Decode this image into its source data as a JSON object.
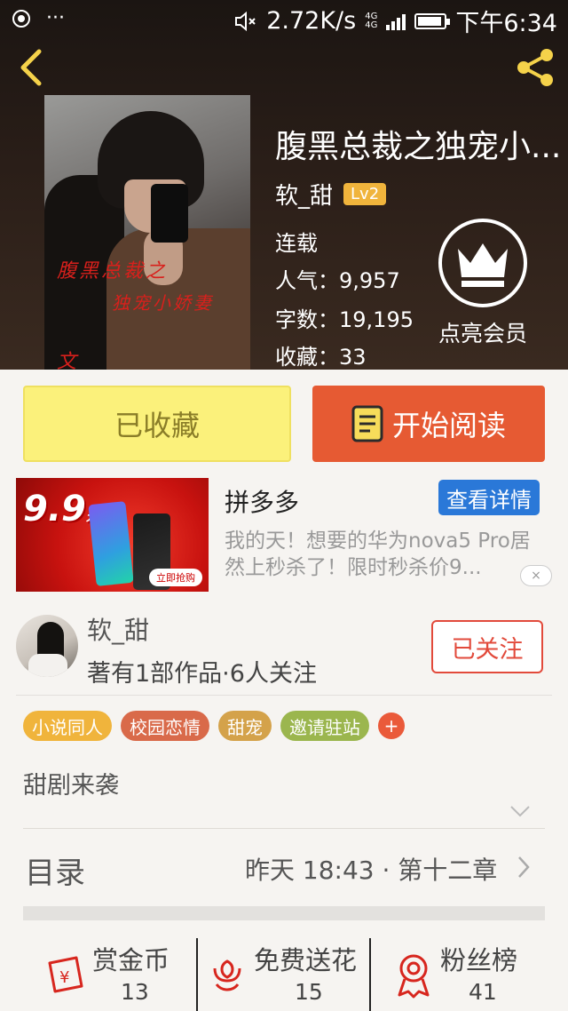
{
  "status_bar": {
    "menu_dots": "···",
    "speed": "2.72K/s",
    "net_type_1": "4G",
    "net_type_2": "4G",
    "time": "下午6:34"
  },
  "book": {
    "title": "腹黑总裁之独宠小...",
    "author": "软_甜",
    "author_level": "Lv2",
    "status": "连载",
    "popularity_label": "人气：",
    "popularity": "9,957",
    "words_label": "字数：",
    "words": "19,195",
    "favorites_label": "收藏：",
    "favorites": "33",
    "cover_text_line1": "腹黑总裁之",
    "cover_text_line2": "独宠小娇妻",
    "cover_text_line3": "文"
  },
  "vip": {
    "label": "点亮会员"
  },
  "actions": {
    "favorited_label": "已收藏",
    "read_label": "开始阅读"
  },
  "ad": {
    "price_text": "9.9",
    "price_unit": "元",
    "grab_text": "立即抢购",
    "title": "拼多多",
    "detail_button": "查看详情",
    "description": "我的天！想要的华为nova5 Pro居然上秒杀了！限时秒杀价9...",
    "close_icon": "close-icon"
  },
  "author_info": {
    "name": "软_甜",
    "stats": "著有1部作品·6人关注",
    "follow_button": "已关注"
  },
  "tags": [
    {
      "label": "小说同人",
      "color": "#f0b43c"
    },
    {
      "label": "校园恋情",
      "color": "#d96a4a"
    },
    {
      "label": "甜宠",
      "color": "#d4a24a"
    },
    {
      "label": "邀请驻站",
      "color": "#9bb64e"
    }
  ],
  "tag_add": "+",
  "summary": "甜剧来袭",
  "toc": {
    "label": "目录",
    "update": "昨天 18:43 · 第十二章"
  },
  "bottom_stats": [
    {
      "label": "赏金币",
      "value": "13",
      "icon": "reward-coin-icon"
    },
    {
      "label": "免费送花",
      "value": "15",
      "icon": "flower-icon"
    },
    {
      "label": "粉丝榜",
      "value": "41",
      "icon": "medal-icon"
    }
  ],
  "colors": {
    "accent_orange": "#e65a33",
    "fav_yellow": "#fbf17b",
    "follow_red": "#e24a3b",
    "detail_blue": "#2a78d8"
  }
}
